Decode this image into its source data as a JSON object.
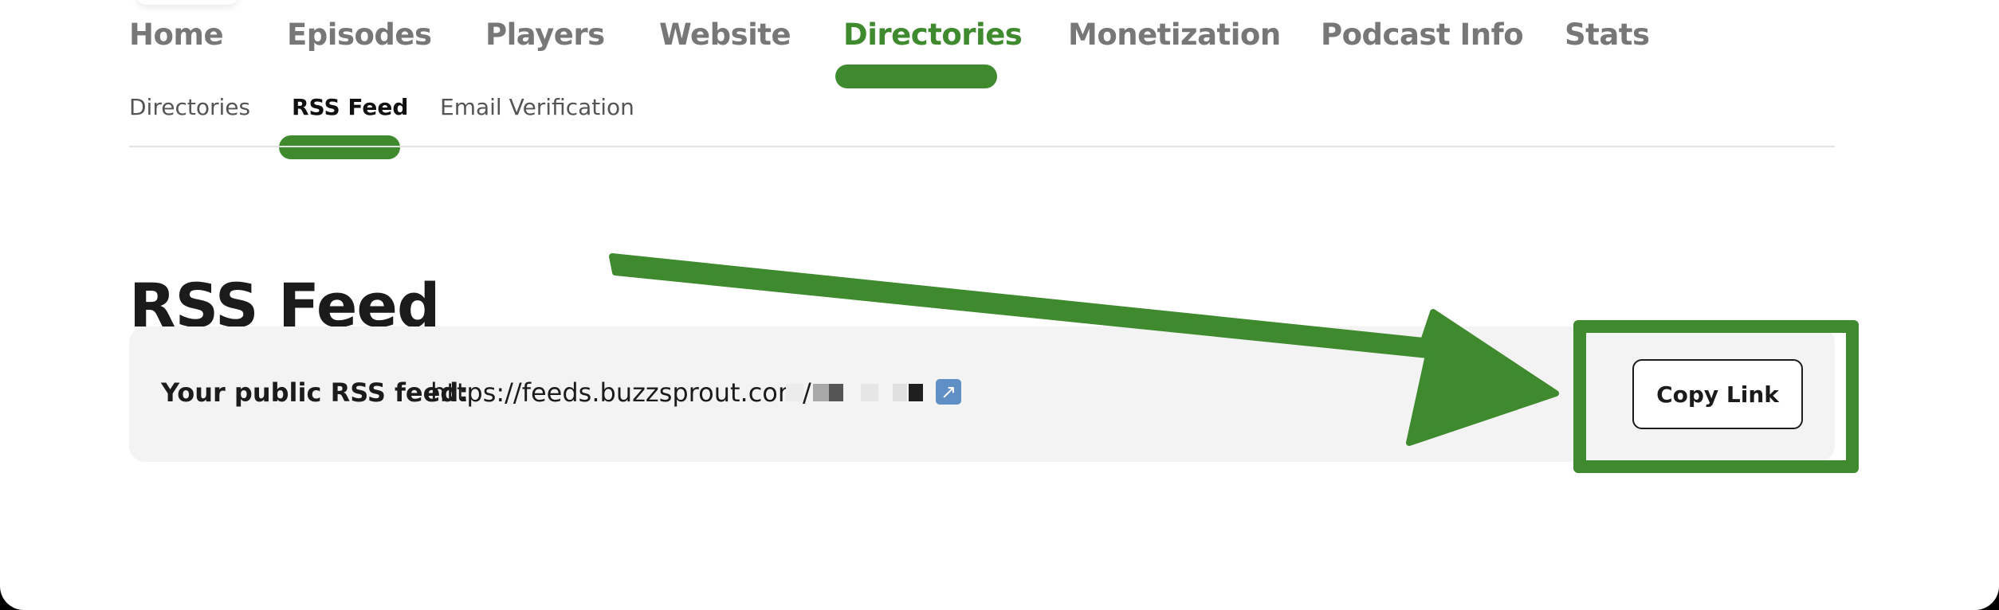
{
  "nav": {
    "main": [
      "Home",
      "Episodes",
      "Players",
      "Website",
      "Directories",
      "Monetization",
      "Podcast Info",
      "Stats"
    ],
    "active_main": "Directories",
    "sub": [
      "Directories",
      "RSS Feed",
      "Email Verification"
    ],
    "active_sub": "RSS Feed"
  },
  "page": {
    "title": "RSS Feed"
  },
  "feed": {
    "label": "Your public RSS feed:",
    "url": "https://feeds.buzzsprout.com/",
    "url_redacted": true
  },
  "actions": {
    "copy_link": "Copy Link"
  },
  "colors": {
    "accent": "#3f8a2f",
    "nav_text": "#777777",
    "panel_bg": "#f2f3f2"
  },
  "icons": {
    "external_link": "external-link-icon"
  }
}
